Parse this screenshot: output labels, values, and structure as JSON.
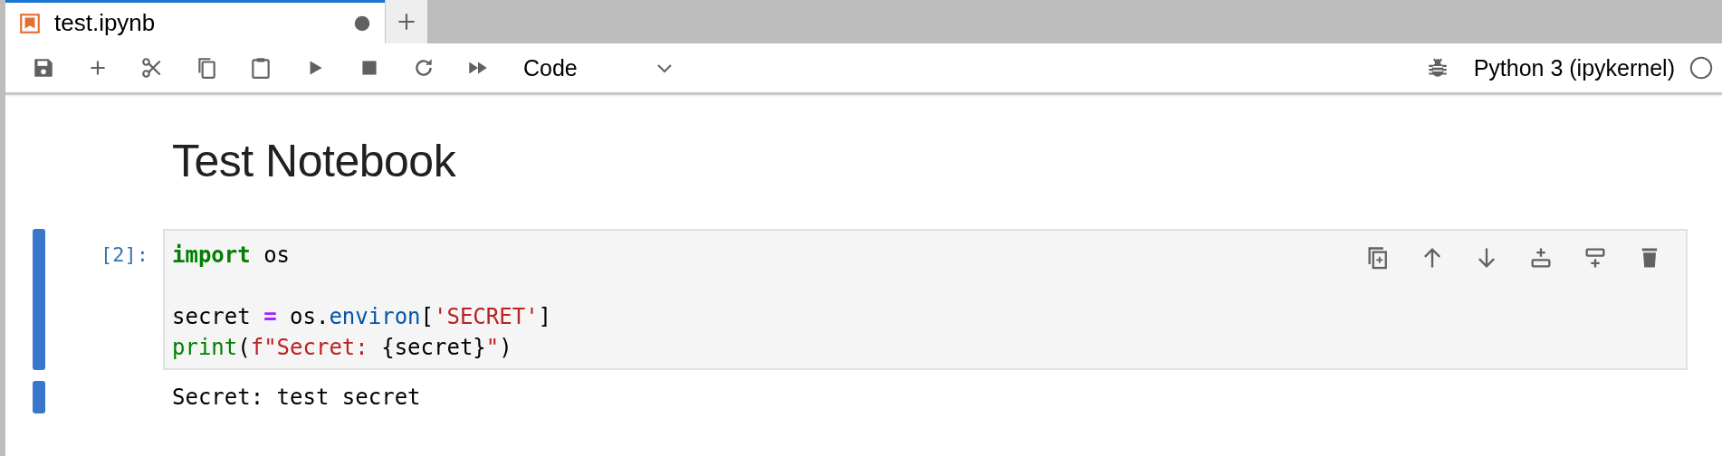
{
  "tabs": [
    {
      "label": "test.ipynb",
      "selected": true,
      "dirty": true
    }
  ],
  "toolbar": {
    "cell_type": "Code"
  },
  "kernel": {
    "name": "Python 3 (ipykernel)",
    "busy": false
  },
  "cells": [
    {
      "kind": "markdown",
      "heading": "Test Notebook",
      "selected": false
    },
    {
      "kind": "code",
      "selected": true,
      "prompt": "[2]:",
      "lines": [
        {
          "kind": "code",
          "tokens": [
            {
              "kind": "keyword",
              "text": "import"
            },
            {
              "kind": "plain",
              "text": " os"
            }
          ]
        },
        {
          "kind": "blank"
        },
        {
          "kind": "code",
          "tokens": [
            {
              "kind": "plain",
              "text": "secret "
            },
            {
              "kind": "operator",
              "text": "="
            },
            {
              "kind": "plain",
              "text": " os."
            },
            {
              "kind": "attr",
              "text": "environ"
            },
            {
              "kind": "plain",
              "text": "["
            },
            {
              "kind": "string",
              "text": "'SECRET'"
            },
            {
              "kind": "plain",
              "text": "]"
            }
          ]
        },
        {
          "kind": "code",
          "tokens": [
            {
              "kind": "builtin",
              "text": "print"
            },
            {
              "kind": "plain",
              "text": "("
            },
            {
              "kind": "string",
              "text": "f\"Secret: "
            },
            {
              "kind": "plain",
              "text": "{secret}"
            },
            {
              "kind": "string",
              "text": "\""
            },
            {
              "kind": "plain",
              "text": ")"
            }
          ]
        }
      ],
      "output": "Secret: test secret"
    }
  ]
}
